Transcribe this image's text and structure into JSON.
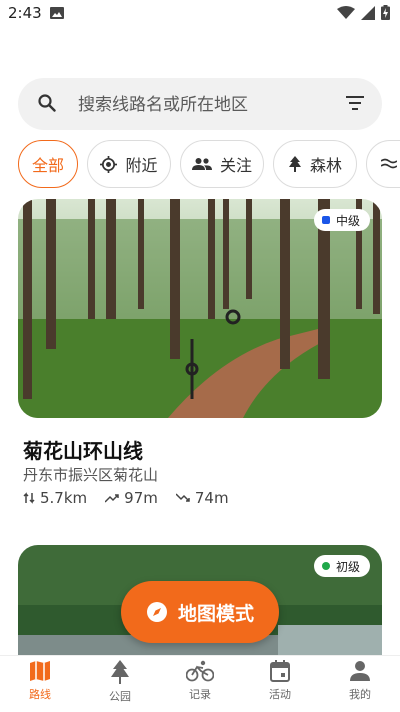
{
  "status_bar": {
    "time": "2:43"
  },
  "search": {
    "placeholder": "搜索线路名或所在地区"
  },
  "chips": [
    {
      "label": "全部",
      "icon": "none",
      "active": true
    },
    {
      "label": "附近",
      "icon": "locate-icon"
    },
    {
      "label": "关注",
      "icon": "people-icon"
    },
    {
      "label": "森林",
      "icon": "tree-icon"
    },
    {
      "label": "",
      "icon": "waves-icon"
    }
  ],
  "routes": [
    {
      "level": "中级",
      "level_color": "#1a56e8",
      "title": "菊花山环山线",
      "location": "丹东市振兴区菊花山",
      "distance": "5.7km",
      "ascent": "97m",
      "descent": "74m"
    },
    {
      "level": "初级",
      "level_color": "#1fa84a"
    }
  ],
  "map_mode": {
    "label": "地图模式"
  },
  "nav": [
    {
      "label": "路线",
      "icon": "map-icon",
      "active": true
    },
    {
      "label": "公园",
      "icon": "tree-icon"
    },
    {
      "label": "记录",
      "icon": "bike-icon"
    },
    {
      "label": "活动",
      "icon": "calendar-icon"
    },
    {
      "label": "我的",
      "icon": "person-icon"
    }
  ],
  "colors": {
    "accent": "#f26a1b"
  }
}
